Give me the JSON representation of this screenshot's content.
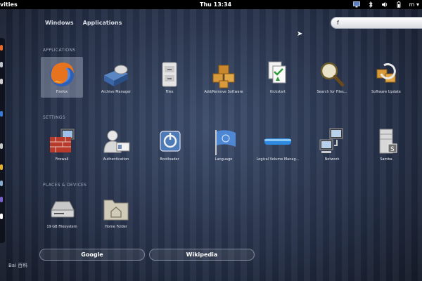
{
  "topbar": {
    "activities": "vities",
    "clock": "Thu 13:34",
    "icons": [
      "monitor-icon",
      "bluetooth-icon",
      "volume-icon",
      "battery-icon",
      "user-icon"
    ]
  },
  "tabs": {
    "windows": "Windows",
    "applications": "Applications"
  },
  "search": {
    "value": "f"
  },
  "sections": {
    "applications": "APPLICATIONS",
    "settings": "SETTINGS",
    "places": "PLACES & DEVICES"
  },
  "applications": [
    {
      "label": "Firefox",
      "icon": "firefox-icon"
    },
    {
      "label": "Archive Manager",
      "icon": "archive-icon"
    },
    {
      "label": "Files",
      "icon": "files-icon"
    },
    {
      "label": "Add/Remove Software",
      "icon": "package-icon"
    },
    {
      "label": "Kickstart",
      "icon": "kickstart-icon"
    },
    {
      "label": "Search for Files...",
      "icon": "search-icon"
    },
    {
      "label": "Software Update",
      "icon": "update-icon"
    }
  ],
  "settings": [
    {
      "label": "Firewall",
      "icon": "firewall-icon"
    },
    {
      "label": "Authentication",
      "icon": "authentication-icon"
    },
    {
      "label": "Bootloader",
      "icon": "bootloader-icon"
    },
    {
      "label": "Language",
      "icon": "language-icon"
    },
    {
      "label": "Logical Volume Manag...",
      "icon": "lvm-icon"
    },
    {
      "label": "Network",
      "icon": "network-icon"
    },
    {
      "label": "Samba",
      "icon": "samba-icon"
    }
  ],
  "places": [
    {
      "label": "19 GB Filesystem",
      "icon": "drive-icon"
    },
    {
      "label": "Home Folder",
      "icon": "home-folder-icon"
    }
  ],
  "providers": {
    "google": "Google",
    "wikipedia": "Wikipedia"
  },
  "watermark": "Bai 百科"
}
